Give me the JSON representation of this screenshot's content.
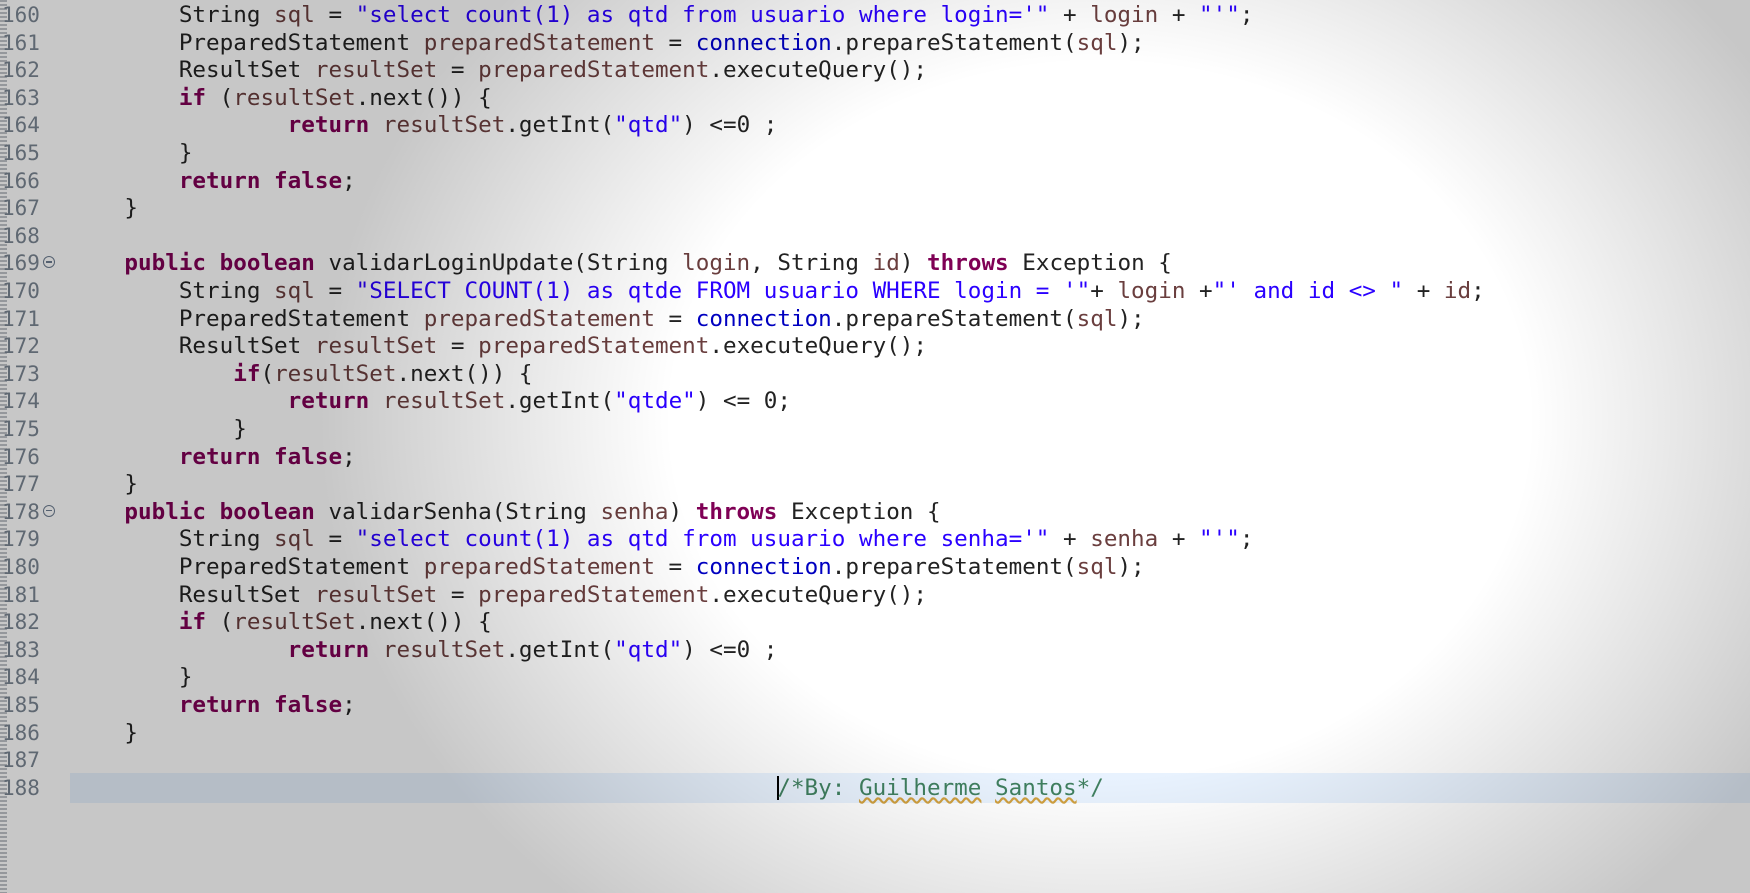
{
  "editor": {
    "lines": [
      {
        "num": "160",
        "fold": false,
        "current": false,
        "indent": "        ",
        "tokens": [
          [
            "plain",
            "String "
          ],
          [
            "loc",
            "sql"
          ],
          [
            "plain",
            " = "
          ],
          [
            "str",
            "\"select count(1) as qtd from usuario where login='\""
          ],
          [
            "plain",
            " + "
          ],
          [
            "loc",
            "login"
          ],
          [
            "plain",
            " + "
          ],
          [
            "str",
            "\"'\""
          ],
          [
            "plain",
            ";"
          ]
        ]
      },
      {
        "num": "161",
        "fold": false,
        "current": false,
        "indent": "        ",
        "tokens": [
          [
            "plain",
            "PreparedStatement "
          ],
          [
            "loc",
            "preparedStatement"
          ],
          [
            "plain",
            " = "
          ],
          [
            "fld",
            "connection"
          ],
          [
            "plain",
            ".prepareStatement("
          ],
          [
            "loc",
            "sql"
          ],
          [
            "plain",
            ");"
          ]
        ]
      },
      {
        "num": "162",
        "fold": false,
        "current": false,
        "indent": "        ",
        "tokens": [
          [
            "plain",
            "ResultSet "
          ],
          [
            "loc",
            "resultSet"
          ],
          [
            "plain",
            " = "
          ],
          [
            "loc",
            "preparedStatement"
          ],
          [
            "plain",
            ".executeQuery();"
          ]
        ]
      },
      {
        "num": "163",
        "fold": false,
        "current": false,
        "indent": "        ",
        "tokens": [
          [
            "kw",
            "if"
          ],
          [
            "plain",
            " ("
          ],
          [
            "loc",
            "resultSet"
          ],
          [
            "plain",
            ".next()) {"
          ]
        ]
      },
      {
        "num": "164",
        "fold": false,
        "current": false,
        "indent": "                ",
        "tokens": [
          [
            "kw",
            "return"
          ],
          [
            "plain",
            " "
          ],
          [
            "loc",
            "resultSet"
          ],
          [
            "plain",
            ".getInt("
          ],
          [
            "str",
            "\"qtd\""
          ],
          [
            "plain",
            ") <=0 ;"
          ]
        ]
      },
      {
        "num": "165",
        "fold": false,
        "current": false,
        "indent": "        ",
        "tokens": [
          [
            "plain",
            "}"
          ]
        ]
      },
      {
        "num": "166",
        "fold": false,
        "current": false,
        "indent": "        ",
        "tokens": [
          [
            "kw",
            "return false"
          ],
          [
            "plain",
            ";"
          ]
        ]
      },
      {
        "num": "167",
        "fold": false,
        "current": false,
        "indent": "    ",
        "tokens": [
          [
            "plain",
            "}"
          ]
        ]
      },
      {
        "num": "168",
        "fold": false,
        "current": false,
        "indent": "",
        "tokens": []
      },
      {
        "num": "169",
        "fold": true,
        "current": false,
        "indent": "    ",
        "tokens": [
          [
            "kw",
            "public boolean"
          ],
          [
            "plain",
            " validarLoginUpdate(String "
          ],
          [
            "loc",
            "login"
          ],
          [
            "plain",
            ", String "
          ],
          [
            "loc",
            "id"
          ],
          [
            "plain",
            ") "
          ],
          [
            "kw",
            "throws"
          ],
          [
            "plain",
            " Exception {"
          ]
        ]
      },
      {
        "num": "170",
        "fold": false,
        "current": false,
        "indent": "        ",
        "tokens": [
          [
            "plain",
            "String "
          ],
          [
            "loc",
            "sql"
          ],
          [
            "plain",
            " = "
          ],
          [
            "str",
            "\"SELECT COUNT(1) as qtde FROM usuario WHERE login = '\""
          ],
          [
            "plain",
            "+ "
          ],
          [
            "loc",
            "login"
          ],
          [
            "plain",
            " +"
          ],
          [
            "str",
            "\"' and id <> \""
          ],
          [
            "plain",
            " + "
          ],
          [
            "loc",
            "id"
          ],
          [
            "plain",
            ";"
          ]
        ]
      },
      {
        "num": "171",
        "fold": false,
        "current": false,
        "indent": "        ",
        "tokens": [
          [
            "plain",
            "PreparedStatement "
          ],
          [
            "loc",
            "preparedStatement"
          ],
          [
            "plain",
            " = "
          ],
          [
            "fld",
            "connection"
          ],
          [
            "plain",
            ".prepareStatement("
          ],
          [
            "loc",
            "sql"
          ],
          [
            "plain",
            ");"
          ]
        ]
      },
      {
        "num": "172",
        "fold": false,
        "current": false,
        "indent": "        ",
        "tokens": [
          [
            "plain",
            "ResultSet "
          ],
          [
            "loc",
            "resultSet"
          ],
          [
            "plain",
            " = "
          ],
          [
            "loc",
            "preparedStatement"
          ],
          [
            "plain",
            ".executeQuery();"
          ]
        ]
      },
      {
        "num": "173",
        "fold": false,
        "current": false,
        "indent": "            ",
        "tokens": [
          [
            "kw",
            "if"
          ],
          [
            "plain",
            "("
          ],
          [
            "loc",
            "resultSet"
          ],
          [
            "plain",
            ".next()) {"
          ]
        ]
      },
      {
        "num": "174",
        "fold": false,
        "current": false,
        "indent": "                ",
        "tokens": [
          [
            "kw",
            "return"
          ],
          [
            "plain",
            " "
          ],
          [
            "loc",
            "resultSet"
          ],
          [
            "plain",
            ".getInt("
          ],
          [
            "str",
            "\"qtde\""
          ],
          [
            "plain",
            ") <= 0;"
          ]
        ]
      },
      {
        "num": "175",
        "fold": false,
        "current": false,
        "indent": "            ",
        "tokens": [
          [
            "plain",
            "}"
          ]
        ]
      },
      {
        "num": "176",
        "fold": false,
        "current": false,
        "indent": "        ",
        "tokens": [
          [
            "kw",
            "return false"
          ],
          [
            "plain",
            ";"
          ]
        ]
      },
      {
        "num": "177",
        "fold": false,
        "current": false,
        "indent": "    ",
        "tokens": [
          [
            "plain",
            "}"
          ]
        ]
      },
      {
        "num": "178",
        "fold": true,
        "current": false,
        "indent": "    ",
        "tokens": [
          [
            "kw",
            "public boolean"
          ],
          [
            "plain",
            " validarSenha(String "
          ],
          [
            "loc",
            "senha"
          ],
          [
            "plain",
            ") "
          ],
          [
            "kw",
            "throws"
          ],
          [
            "plain",
            " Exception {"
          ]
        ]
      },
      {
        "num": "179",
        "fold": false,
        "current": false,
        "indent": "        ",
        "tokens": [
          [
            "plain",
            "String "
          ],
          [
            "loc",
            "sql"
          ],
          [
            "plain",
            " = "
          ],
          [
            "str",
            "\"select count(1) as qtd from usuario where senha='\""
          ],
          [
            "plain",
            " + "
          ],
          [
            "loc",
            "senha"
          ],
          [
            "plain",
            " + "
          ],
          [
            "str",
            "\"'\""
          ],
          [
            "plain",
            ";"
          ]
        ]
      },
      {
        "num": "180",
        "fold": false,
        "current": false,
        "indent": "        ",
        "tokens": [
          [
            "plain",
            "PreparedStatement "
          ],
          [
            "loc",
            "preparedStatement"
          ],
          [
            "plain",
            " = "
          ],
          [
            "fld",
            "connection"
          ],
          [
            "plain",
            ".prepareStatement("
          ],
          [
            "loc",
            "sql"
          ],
          [
            "plain",
            ");"
          ]
        ]
      },
      {
        "num": "181",
        "fold": false,
        "current": false,
        "indent": "        ",
        "tokens": [
          [
            "plain",
            "ResultSet "
          ],
          [
            "loc",
            "resultSet"
          ],
          [
            "plain",
            " = "
          ],
          [
            "loc",
            "preparedStatement"
          ],
          [
            "plain",
            ".executeQuery();"
          ]
        ]
      },
      {
        "num": "182",
        "fold": false,
        "current": false,
        "indent": "        ",
        "tokens": [
          [
            "kw",
            "if"
          ],
          [
            "plain",
            " ("
          ],
          [
            "loc",
            "resultSet"
          ],
          [
            "plain",
            ".next()) {"
          ]
        ]
      },
      {
        "num": "183",
        "fold": false,
        "current": false,
        "indent": "                ",
        "tokens": [
          [
            "kw",
            "return"
          ],
          [
            "plain",
            " "
          ],
          [
            "loc",
            "resultSet"
          ],
          [
            "plain",
            ".getInt("
          ],
          [
            "str",
            "\"qtd\""
          ],
          [
            "plain",
            ") <=0 ;"
          ]
        ]
      },
      {
        "num": "184",
        "fold": false,
        "current": false,
        "indent": "        ",
        "tokens": [
          [
            "plain",
            "}"
          ]
        ]
      },
      {
        "num": "185",
        "fold": false,
        "current": false,
        "indent": "        ",
        "tokens": [
          [
            "kw",
            "return false"
          ],
          [
            "plain",
            ";"
          ]
        ]
      },
      {
        "num": "186",
        "fold": false,
        "current": false,
        "indent": "    ",
        "tokens": [
          [
            "plain",
            "}"
          ]
        ]
      },
      {
        "num": "187",
        "fold": false,
        "current": false,
        "indent": "",
        "tokens": []
      },
      {
        "num": "188",
        "fold": false,
        "current": true,
        "indent": "                                                    ",
        "tokens": [
          [
            "caret",
            ""
          ],
          [
            "cmt",
            "/*By: "
          ],
          [
            "cmt-sq",
            "Guilherme"
          ],
          [
            "cmt",
            " "
          ],
          [
            "cmt-sq",
            "Santos"
          ],
          [
            "cmt",
            "*/"
          ]
        ]
      }
    ]
  }
}
